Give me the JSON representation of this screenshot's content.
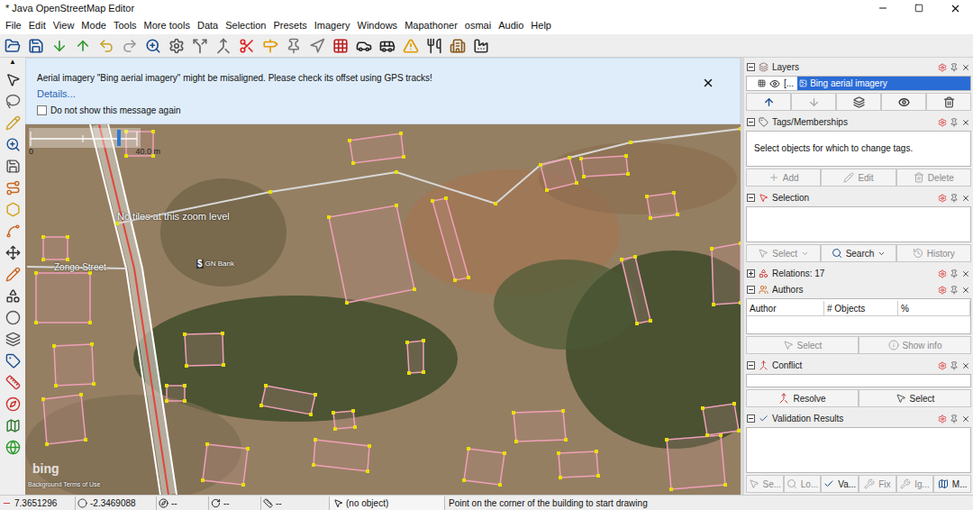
{
  "window": {
    "title": "* Java OpenStreetMap Editor"
  },
  "menu": [
    "File",
    "Edit",
    "View",
    "Mode",
    "Tools",
    "More tools",
    "Data",
    "Selection",
    "Presets",
    "Imagery",
    "Windows",
    "Mapathoner",
    "osmai",
    "Audio",
    "Help"
  ],
  "left_toolbar": {
    "scroll_up": "▲"
  },
  "notification": {
    "message": "Aerial imagery \"Bing aerial imagery\" might be misaligned. Please check its offset using GPS tracks!",
    "link": "Details...",
    "checkbox": {
      "label": "Do not show this message again",
      "checked": false
    }
  },
  "map": {
    "scale": {
      "start": "0",
      "end": "40.0 m"
    },
    "no_tiles": "No tiles at this zoom level",
    "street": "Zongo Street",
    "poi": {
      "icon": "$",
      "name": "GN Bank"
    },
    "logo": "bing",
    "attribution": "Background Terms of Use"
  },
  "layers": {
    "title": "Layers",
    "expanded": true,
    "items": [
      {
        "prefix": "[...",
        "name": "Bing aerial imagery",
        "visible": true,
        "selected": true
      }
    ]
  },
  "tags": {
    "title": "Tags/Memberships",
    "expanded": true,
    "hint": "Select objects for which to change tags.",
    "buttons": [
      {
        "label": "Add",
        "disabled": true
      },
      {
        "label": "Edit",
        "disabled": true
      },
      {
        "label": "Delete",
        "disabled": true
      }
    ]
  },
  "selection": {
    "title": "Selection",
    "expanded": true,
    "buttons": [
      {
        "label": "Select",
        "disabled": true
      },
      {
        "label": "Search",
        "disabled": false
      },
      {
        "label": "History",
        "disabled": true
      }
    ]
  },
  "relations": {
    "title": "Relations: 17",
    "expanded": false
  },
  "authors": {
    "title": "Authors",
    "expanded": true,
    "columns": [
      "Author",
      "# Objects",
      "%"
    ],
    "buttons": [
      {
        "label": "Select",
        "disabled": true
      },
      {
        "label": "Show info",
        "disabled": true
      }
    ]
  },
  "conflict": {
    "title": "Conflict",
    "expanded": true,
    "buttons": [
      {
        "label": "Resolve",
        "disabled": false
      },
      {
        "label": "Select",
        "disabled": false
      }
    ]
  },
  "validation": {
    "title": "Validation Results",
    "expanded": true,
    "buttons": [
      {
        "label": "Se...",
        "disabled": true
      },
      {
        "label": "Lo...",
        "disabled": true
      },
      {
        "label": "Va...",
        "disabled": false
      },
      {
        "label": "Fix",
        "disabled": true
      },
      {
        "label": "Ig...",
        "disabled": true
      },
      {
        "label": "M...",
        "disabled": false
      }
    ]
  },
  "status_bar": {
    "lat": "7.3651296",
    "lon": "-2.3469088",
    "heading": "--",
    "angle": "--",
    "length": "--",
    "object": "(no object)",
    "help": "Point on the corner of the building to start drawing"
  }
}
